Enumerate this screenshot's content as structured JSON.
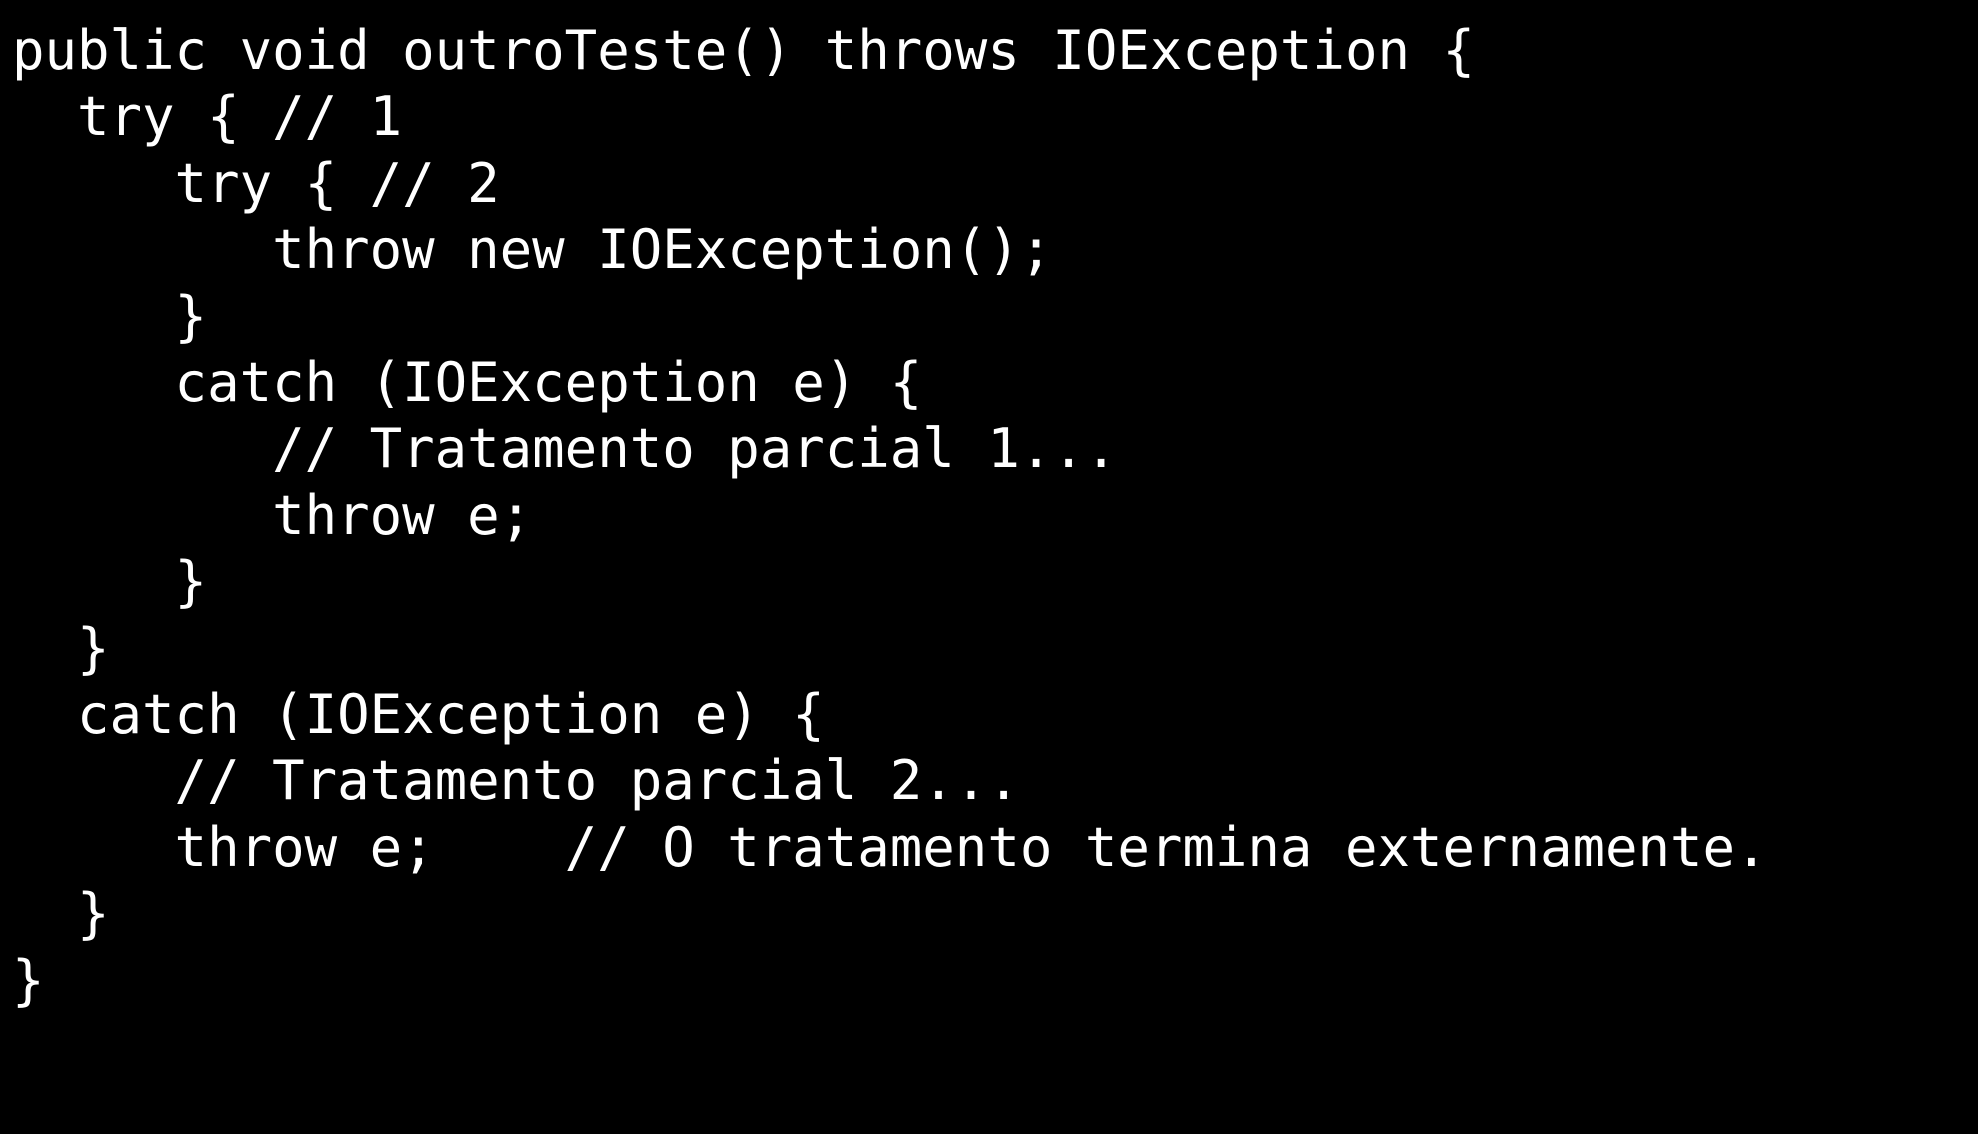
{
  "code": {
    "lines": [
      "public void outroTeste() throws IOException {",
      "  try { // 1",
      "     try { // 2",
      "        throw new IOException();",
      "     }",
      "     catch (IOException e) {",
      "        // Tratamento parcial 1...",
      "        throw e;",
      "     }",
      "  }",
      "  catch (IOException e) {",
      "     // Tratamento parcial 2...",
      "     throw e;    // O tratamento termina externamente.",
      "  }",
      "}"
    ]
  }
}
